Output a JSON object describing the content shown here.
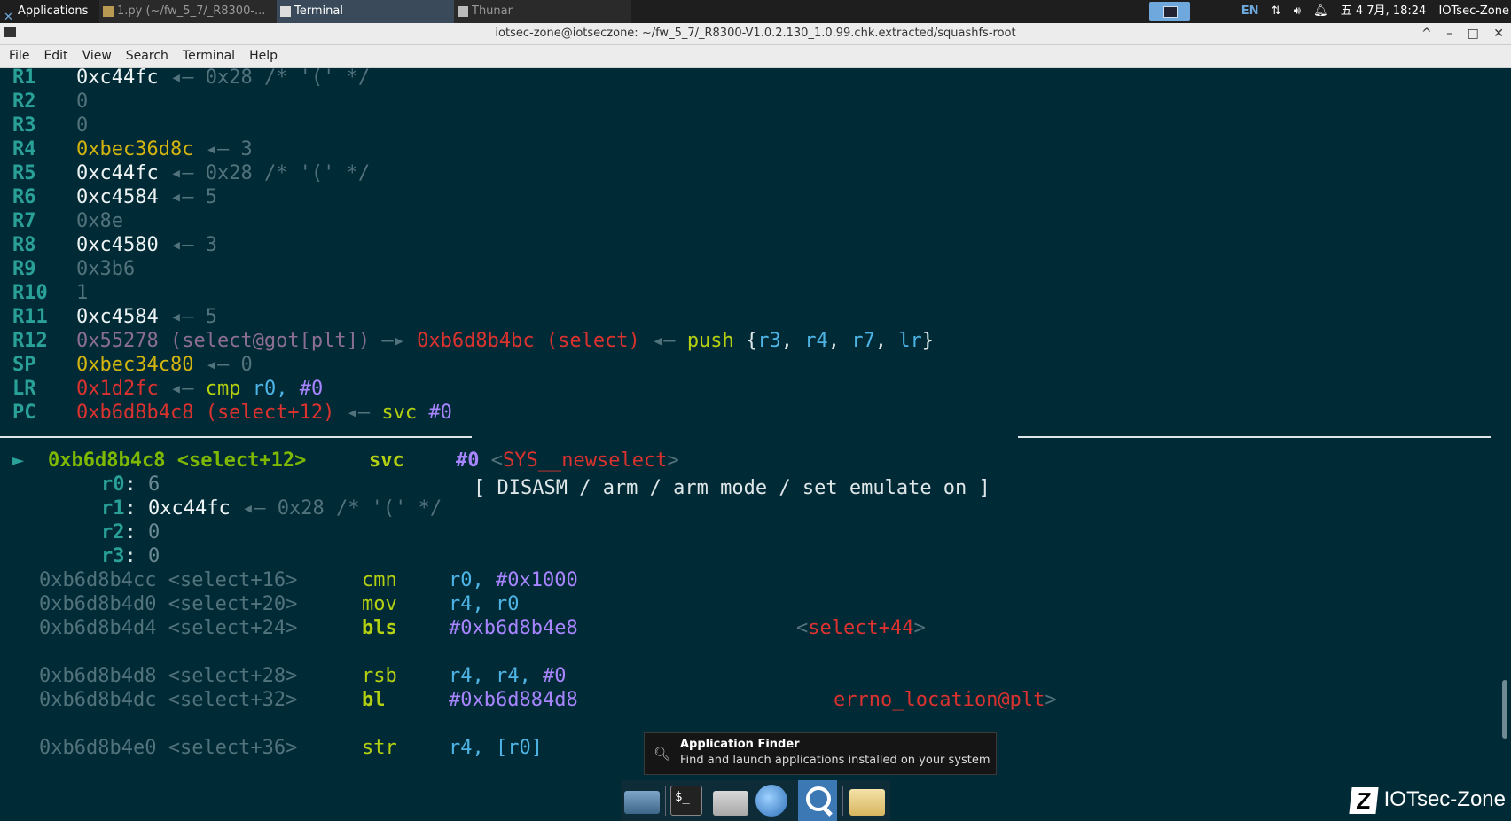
{
  "panel": {
    "applications": "Applications",
    "task_py": "1.py (~/fw_5_7/_R8300-...",
    "task_terminal": "Terminal",
    "task_thunar": "Thunar",
    "lang": "EN",
    "datetime": "五 4 7月, 18:24",
    "user": "IOTsec-Zone"
  },
  "window": {
    "title": "iotsec-zone@iotseczone: ~/fw_5_7/_R8300-V1.0.2.130_1.0.99.chk.extracted/squashfs-root",
    "controls": [
      "^",
      "–",
      "□",
      "✕"
    ]
  },
  "menubar": [
    "File",
    "Edit",
    "View",
    "Search",
    "Terminal",
    "Help"
  ],
  "registers": {
    "R1": {
      "name": "R1",
      "value": "0xc44fc",
      "arrow": "◂—",
      "deref": "0x28 /* '(' */"
    },
    "R2": {
      "name": "R2",
      "value": "0"
    },
    "R3": {
      "name": "R3",
      "value": "0"
    },
    "R4": {
      "name": "R4",
      "value": "0xbec36d8c",
      "arrow": "◂—",
      "deref": "3"
    },
    "R5": {
      "name": "R5",
      "value": "0xc44fc",
      "arrow": "◂—",
      "deref": "0x28 /* '(' */"
    },
    "R6": {
      "name": "R6",
      "value": "0xc4584",
      "arrow": "◂—",
      "deref": "5"
    },
    "R7": {
      "name": "R7",
      "value": "0x8e"
    },
    "R8": {
      "name": "R8",
      "value": "0xc4580",
      "arrow": "◂—",
      "deref": "3"
    },
    "R9": {
      "name": "R9",
      "value": "0x3b6"
    },
    "R10": {
      "name": "R10",
      "value": "1"
    },
    "R11": {
      "name": "R11",
      "value": "0xc4584",
      "arrow": "◂—",
      "deref": "5"
    },
    "R12": {
      "name": "R12",
      "value": "0x55278 (select@got[plt])",
      "arrow1": "—▸",
      "target": "0xb6d8b4bc (select)",
      "arrow2": "◂—",
      "ins": "push",
      "args_open": "{",
      "a1": "r3",
      "a2": "r4",
      "a3": "r7",
      "a4": "lr",
      "args_close": "}"
    },
    "SP": {
      "name": "SP",
      "value": "0xbec34c80",
      "arrow": "◂—",
      "deref": "0"
    },
    "LR": {
      "name": "LR",
      "value": "0x1d2fc",
      "arrow": "◂—",
      "ins": "cmp",
      "op1": "r0,",
      "op2": "#0"
    },
    "PC": {
      "name": "PC",
      "value": "0xb6d8b4c8 (select+12)",
      "arrow": "◂—",
      "ins": "svc",
      "op1": "#0"
    }
  },
  "banner": "[ DISASM / arm / arm mode / set emulate on ]",
  "disasm": {
    "current": {
      "marker": "►",
      "addr": "0xb6d8b4c8",
      "sym": "<select+12>",
      "ins": "svc",
      "op": "#0",
      "lt": "<",
      "target": "SYS__newselect",
      "gt": ">"
    },
    "args": [
      {
        "name": "r0",
        "value": "6"
      },
      {
        "name": "r1",
        "value": "0xc44fc",
        "arrow": "◂—",
        "deref": "0x28 /* '(' */"
      },
      {
        "name": "r2",
        "value": "0"
      },
      {
        "name": "r3",
        "value": "0"
      }
    ],
    "rows": [
      {
        "addr": "0xb6d8b4cc",
        "sym": "<select+16>",
        "ins": "cmn",
        "opA": "r0,",
        "opB": "#0x1000"
      },
      {
        "addr": "0xb6d8b4d0",
        "sym": "<select+20>",
        "ins": "mov",
        "opA": "r4,",
        "opB": "r0"
      },
      {
        "addr": "0xb6d8b4d4",
        "sym": "<select+24>",
        "ins": "bls",
        "opA": "#0xb6d8b4e8",
        "lt": "<",
        "target": "select+44",
        "gt": ">"
      },
      {
        "addr": "0xb6d8b4d8",
        "sym": "<select+28>",
        "ins": "rsb",
        "opA": "r4, r4,",
        "opB": "#0"
      },
      {
        "addr": "0xb6d8b4dc",
        "sym": "<select+32>",
        "ins": "bl",
        "opA": "#0xb6d884d8",
        "target": "errno_location@plt",
        "gt": ">"
      },
      {
        "addr": "0xb6d8b4e0",
        "sym": "<select+36>",
        "ins": "str",
        "opA": "r4,",
        "opB": "[r0]"
      }
    ]
  },
  "tooltip": {
    "title": "Application Finder",
    "desc": "Find and launch applications installed on your system"
  },
  "watermark": "IOTsec-Zone",
  "colors": {
    "terminal_bg": "#002b36",
    "accent": "#6fa8dc"
  }
}
